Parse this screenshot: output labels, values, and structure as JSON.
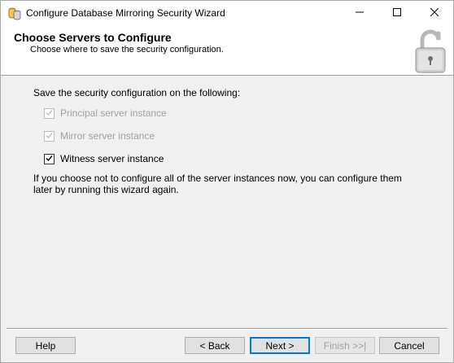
{
  "window": {
    "title": "Configure Database Mirroring Security Wizard"
  },
  "header": {
    "title": "Choose Servers to Configure",
    "subtitle": "Choose where to save the security configuration."
  },
  "main": {
    "prompt": "Save the security configuration on the following:",
    "options": [
      {
        "label": "Principal server instance",
        "checked": true,
        "enabled": false
      },
      {
        "label": "Mirror server instance",
        "checked": true,
        "enabled": false
      },
      {
        "label": "Witness server instance",
        "checked": true,
        "enabled": true
      }
    ],
    "note": "If you choose not to configure all of the server instances now, you can configure them later by running this wizard again."
  },
  "buttons": {
    "help": "Help",
    "back": "< Back",
    "next": "Next >",
    "finish": "Finish >>|",
    "cancel": "Cancel"
  },
  "colors": {
    "accent": "#0078d7",
    "disabled_text": "#a0a0a0",
    "background": "#f0f0f0"
  },
  "icons": {
    "app": "database-icon",
    "header": "lock-icon",
    "minimize": "minimize-icon",
    "maximize": "maximize-icon",
    "close": "close-icon",
    "check": "checkmark-icon"
  }
}
